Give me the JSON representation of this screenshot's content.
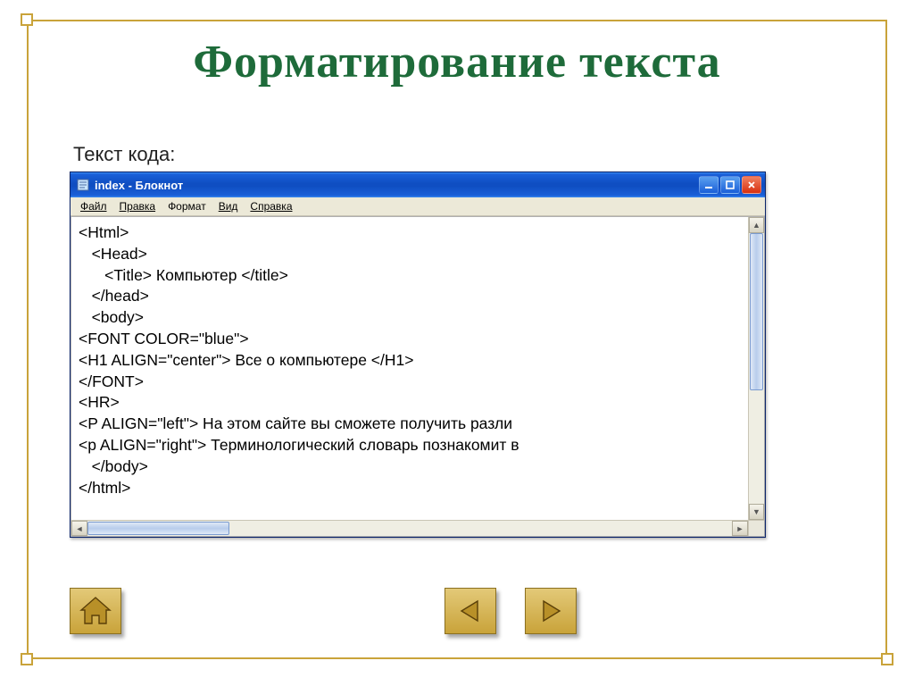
{
  "slide": {
    "title": "Форматирование текста",
    "subtitle": "Текст кода:"
  },
  "window": {
    "title": "index - Блокнот",
    "menu": {
      "file": "Файл",
      "edit": "Правка",
      "format": "Формат",
      "view": "Вид",
      "help": "Справка"
    }
  },
  "code": {
    "l1": "<Html>",
    "l2": "   <Head>",
    "l3": "      <Title> Компьютер </title>",
    "l4": "   </head>",
    "l5": "   <body>",
    "l6": "<FONT COLOR=\"blue\">",
    "l7": "<H1 ALIGN=\"center\"> Все о компьютере </H1>",
    "l8": "</FONT>",
    "l9": "<HR>",
    "l10": "<P ALIGN=\"left\"> На этом сайте вы сможете получить разли",
    "l11": "<p ALIGN=\"right\"> Терминологический словарь познакомит в",
    "l12": "   </body>",
    "l13": "</html>"
  },
  "nav": {
    "home": "home-button",
    "prev": "previous-slide",
    "next": "next-slide"
  }
}
